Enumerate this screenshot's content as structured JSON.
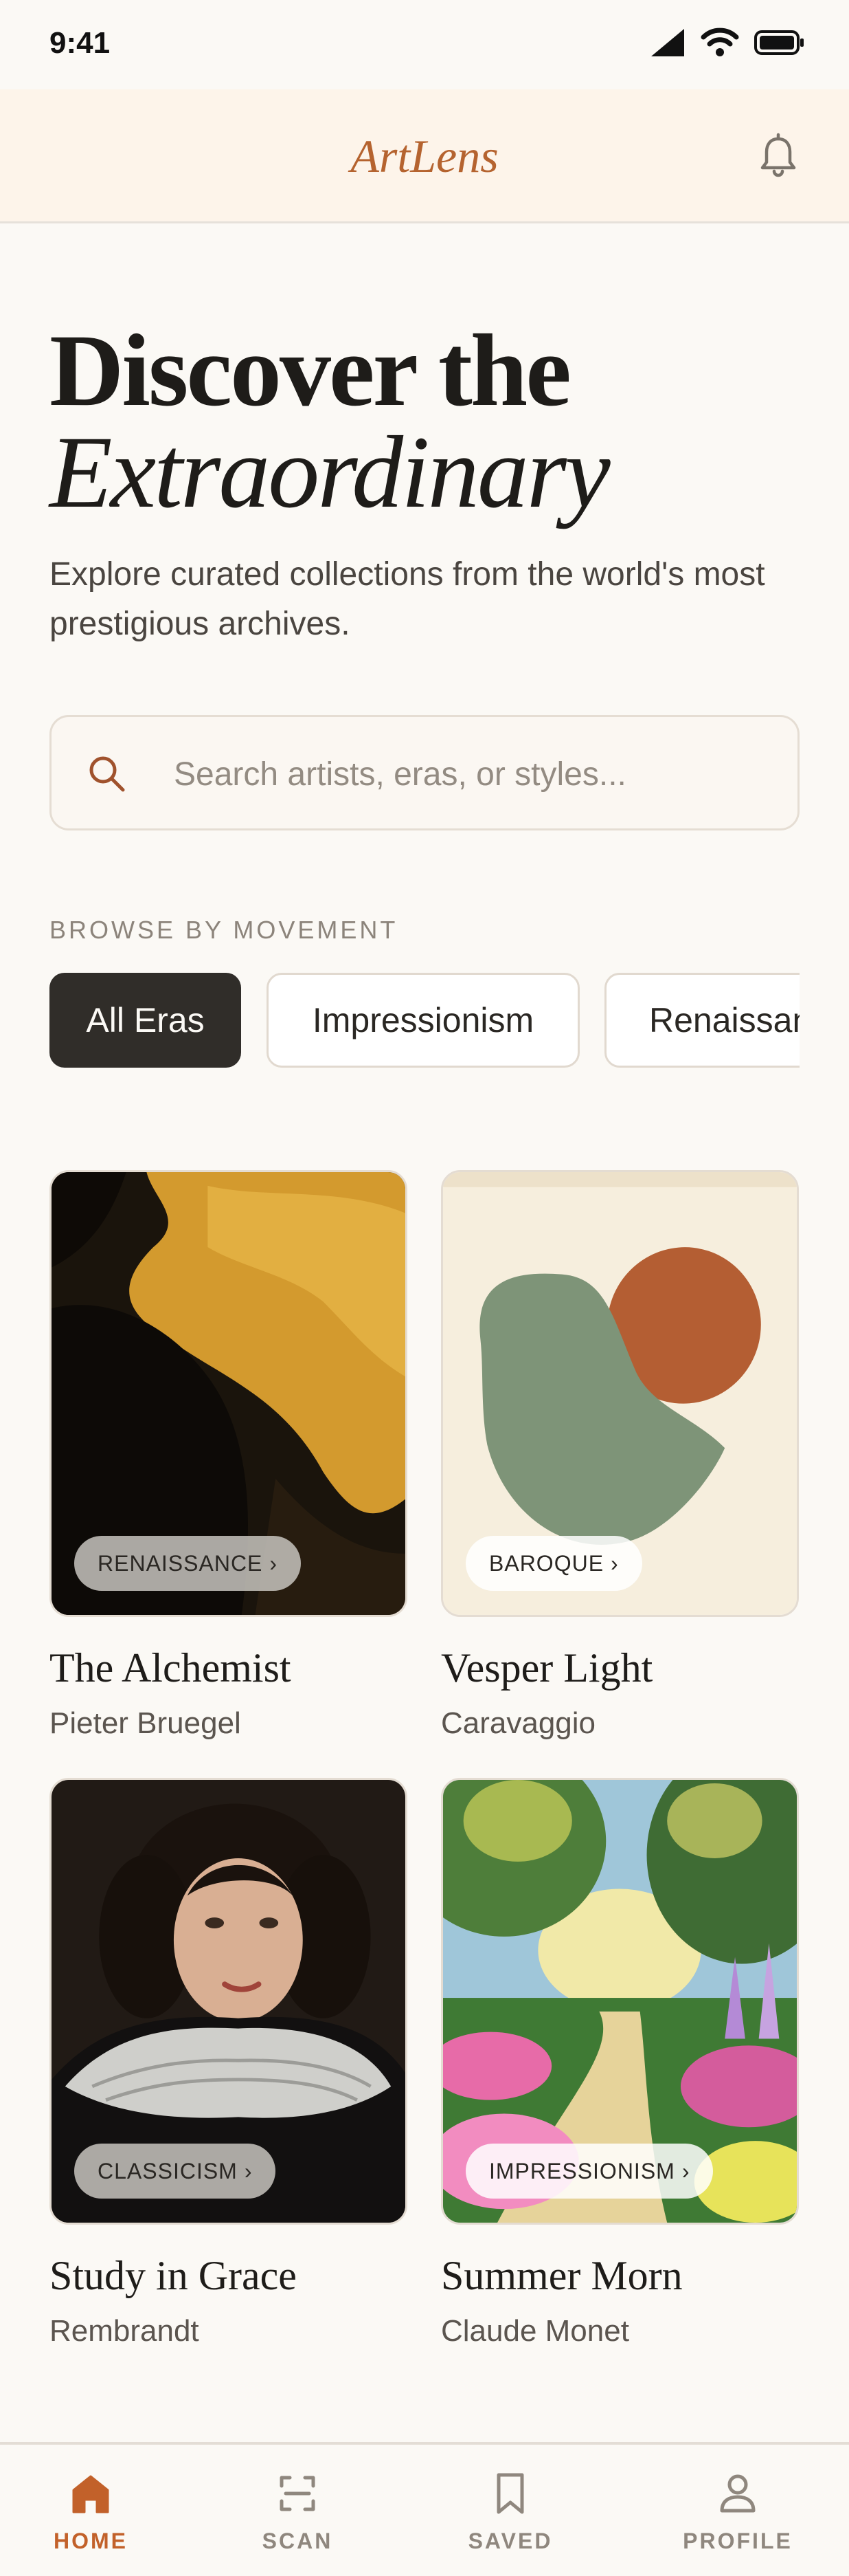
{
  "status_bar": {
    "time": "9:41"
  },
  "header": {
    "logo": "ArtLens"
  },
  "hero": {
    "title_line1": "Discover the",
    "title_line2": "Extraordinary",
    "subtitle": "Explore curated collections from the world's most prestigious archives."
  },
  "search": {
    "placeholder": "Search artists, eras, or styles..."
  },
  "browse": {
    "label": "BROWSE BY MOVEMENT",
    "chips": [
      {
        "label": "All Eras",
        "active": true
      },
      {
        "label": "Impressionism",
        "active": false
      },
      {
        "label": "Renaissance",
        "active": false
      }
    ]
  },
  "artworks": [
    {
      "title": "The Alchemist",
      "artist": "Pieter Bruegel",
      "movement": "RENAISSANCE"
    },
    {
      "title": "Vesper Light",
      "artist": "Caravaggio",
      "movement": "BAROQUE"
    },
    {
      "title": "Study in Grace",
      "artist": "Rembrandt",
      "movement": "CLASSICISM"
    },
    {
      "title": "Summer Morn",
      "artist": "Claude Monet",
      "movement": "IMPRESSIONISM"
    }
  ],
  "tabs": [
    {
      "label": "HOME",
      "icon": "home-icon",
      "active": true
    },
    {
      "label": "SCAN",
      "icon": "scan-icon",
      "active": false
    },
    {
      "label": "SAVED",
      "icon": "bookmark-icon",
      "active": false
    },
    {
      "label": "PROFILE",
      "icon": "user-icon",
      "active": false
    }
  ],
  "colors": {
    "accent": "#B5632F",
    "tab_active": "#C2612A",
    "dark_chip": "#302D29",
    "background": "#FBF9F5"
  }
}
